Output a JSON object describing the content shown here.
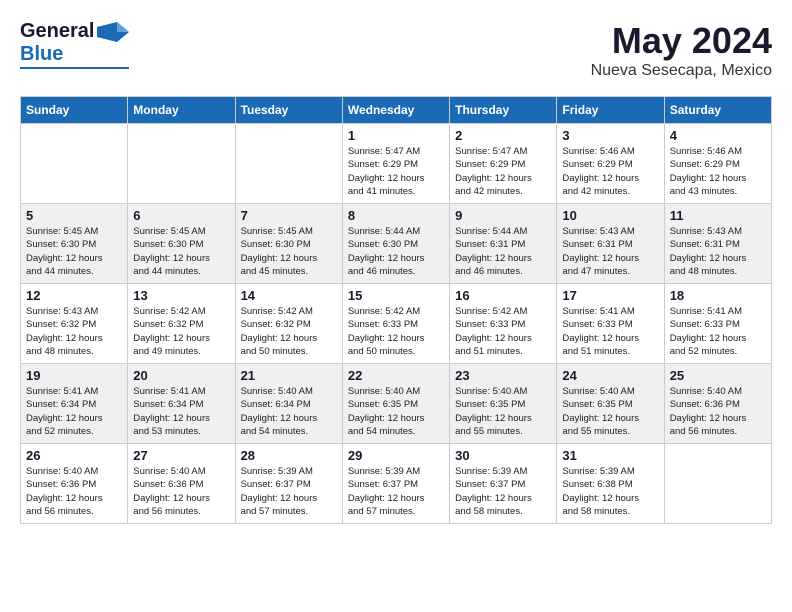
{
  "header": {
    "logo_general": "General",
    "logo_blue": "Blue",
    "month": "May 2024",
    "location": "Nueva Sesecapa, Mexico"
  },
  "weekdays": [
    "Sunday",
    "Monday",
    "Tuesday",
    "Wednesday",
    "Thursday",
    "Friday",
    "Saturday"
  ],
  "weeks": [
    [
      {
        "day": "",
        "info": ""
      },
      {
        "day": "",
        "info": ""
      },
      {
        "day": "",
        "info": ""
      },
      {
        "day": "1",
        "info": "Sunrise: 5:47 AM\nSunset: 6:29 PM\nDaylight: 12 hours\nand 41 minutes."
      },
      {
        "day": "2",
        "info": "Sunrise: 5:47 AM\nSunset: 6:29 PM\nDaylight: 12 hours\nand 42 minutes."
      },
      {
        "day": "3",
        "info": "Sunrise: 5:46 AM\nSunset: 6:29 PM\nDaylight: 12 hours\nand 42 minutes."
      },
      {
        "day": "4",
        "info": "Sunrise: 5:46 AM\nSunset: 6:29 PM\nDaylight: 12 hours\nand 43 minutes."
      }
    ],
    [
      {
        "day": "5",
        "info": "Sunrise: 5:45 AM\nSunset: 6:30 PM\nDaylight: 12 hours\nand 44 minutes."
      },
      {
        "day": "6",
        "info": "Sunrise: 5:45 AM\nSunset: 6:30 PM\nDaylight: 12 hours\nand 44 minutes."
      },
      {
        "day": "7",
        "info": "Sunrise: 5:45 AM\nSunset: 6:30 PM\nDaylight: 12 hours\nand 45 minutes."
      },
      {
        "day": "8",
        "info": "Sunrise: 5:44 AM\nSunset: 6:30 PM\nDaylight: 12 hours\nand 46 minutes."
      },
      {
        "day": "9",
        "info": "Sunrise: 5:44 AM\nSunset: 6:31 PM\nDaylight: 12 hours\nand 46 minutes."
      },
      {
        "day": "10",
        "info": "Sunrise: 5:43 AM\nSunset: 6:31 PM\nDaylight: 12 hours\nand 47 minutes."
      },
      {
        "day": "11",
        "info": "Sunrise: 5:43 AM\nSunset: 6:31 PM\nDaylight: 12 hours\nand 48 minutes."
      }
    ],
    [
      {
        "day": "12",
        "info": "Sunrise: 5:43 AM\nSunset: 6:32 PM\nDaylight: 12 hours\nand 48 minutes."
      },
      {
        "day": "13",
        "info": "Sunrise: 5:42 AM\nSunset: 6:32 PM\nDaylight: 12 hours\nand 49 minutes."
      },
      {
        "day": "14",
        "info": "Sunrise: 5:42 AM\nSunset: 6:32 PM\nDaylight: 12 hours\nand 50 minutes."
      },
      {
        "day": "15",
        "info": "Sunrise: 5:42 AM\nSunset: 6:33 PM\nDaylight: 12 hours\nand 50 minutes."
      },
      {
        "day": "16",
        "info": "Sunrise: 5:42 AM\nSunset: 6:33 PM\nDaylight: 12 hours\nand 51 minutes."
      },
      {
        "day": "17",
        "info": "Sunrise: 5:41 AM\nSunset: 6:33 PM\nDaylight: 12 hours\nand 51 minutes."
      },
      {
        "day": "18",
        "info": "Sunrise: 5:41 AM\nSunset: 6:33 PM\nDaylight: 12 hours\nand 52 minutes."
      }
    ],
    [
      {
        "day": "19",
        "info": "Sunrise: 5:41 AM\nSunset: 6:34 PM\nDaylight: 12 hours\nand 52 minutes."
      },
      {
        "day": "20",
        "info": "Sunrise: 5:41 AM\nSunset: 6:34 PM\nDaylight: 12 hours\nand 53 minutes."
      },
      {
        "day": "21",
        "info": "Sunrise: 5:40 AM\nSunset: 6:34 PM\nDaylight: 12 hours\nand 54 minutes."
      },
      {
        "day": "22",
        "info": "Sunrise: 5:40 AM\nSunset: 6:35 PM\nDaylight: 12 hours\nand 54 minutes."
      },
      {
        "day": "23",
        "info": "Sunrise: 5:40 AM\nSunset: 6:35 PM\nDaylight: 12 hours\nand 55 minutes."
      },
      {
        "day": "24",
        "info": "Sunrise: 5:40 AM\nSunset: 6:35 PM\nDaylight: 12 hours\nand 55 minutes."
      },
      {
        "day": "25",
        "info": "Sunrise: 5:40 AM\nSunset: 6:36 PM\nDaylight: 12 hours\nand 56 minutes."
      }
    ],
    [
      {
        "day": "26",
        "info": "Sunrise: 5:40 AM\nSunset: 6:36 PM\nDaylight: 12 hours\nand 56 minutes."
      },
      {
        "day": "27",
        "info": "Sunrise: 5:40 AM\nSunset: 6:36 PM\nDaylight: 12 hours\nand 56 minutes."
      },
      {
        "day": "28",
        "info": "Sunrise: 5:39 AM\nSunset: 6:37 PM\nDaylight: 12 hours\nand 57 minutes."
      },
      {
        "day": "29",
        "info": "Sunrise: 5:39 AM\nSunset: 6:37 PM\nDaylight: 12 hours\nand 57 minutes."
      },
      {
        "day": "30",
        "info": "Sunrise: 5:39 AM\nSunset: 6:37 PM\nDaylight: 12 hours\nand 58 minutes."
      },
      {
        "day": "31",
        "info": "Sunrise: 5:39 AM\nSunset: 6:38 PM\nDaylight: 12 hours\nand 58 minutes."
      },
      {
        "day": "",
        "info": ""
      }
    ]
  ]
}
